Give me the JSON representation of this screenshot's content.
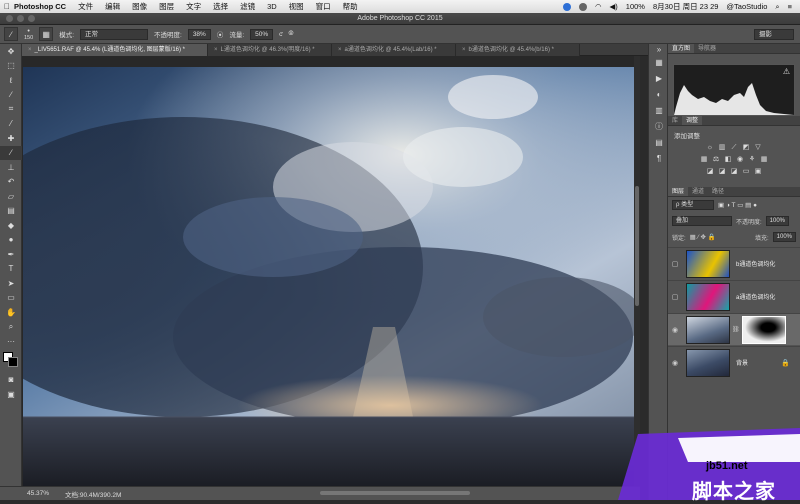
{
  "menubar": {
    "app_name": "Photoshop CC",
    "items": [
      "文件",
      "编辑",
      "图像",
      "图层",
      "文字",
      "选择",
      "滤镜",
      "3D",
      "视图",
      "窗口",
      "帮助"
    ],
    "battery": "100%",
    "datetime": "8月30日 周日  23 29",
    "user": "@TaoStudio"
  },
  "window": {
    "title": "Adobe Photoshop CC 2015"
  },
  "options": {
    "brush_size": "150",
    "mode_label": "模式:",
    "mode_value": "正常",
    "opacity_label": "不透明度:",
    "opacity_value": "38%",
    "flow_label": "流量:",
    "flow_value": "50%",
    "workspace": "摄影"
  },
  "tabs": [
    {
      "label": "_LIV5651.RAF @ 45.4% (L通道色调均化, 图层蒙版/16) *",
      "active": true
    },
    {
      "label": "L通道色调均化 @ 46.3%(明度/16) *",
      "active": false
    },
    {
      "label": "a通道色调均化 @ 45.4%(Lab/16) *",
      "active": false
    },
    {
      "label": "b通道色调均化 @ 45.4%(b/16) *",
      "active": false
    }
  ],
  "status": {
    "zoom": "45.37%",
    "doc": "文档:90.4M/390.2M"
  },
  "panels": {
    "top_tabs": [
      "直方图",
      "导航器"
    ],
    "mid_tabs": [
      "库",
      "调整"
    ],
    "adj_title": "添加调整",
    "layer_tabs": [
      "图层",
      "通道",
      "路径"
    ],
    "filter_label": "ρ 类型",
    "blend_mode": "叠加",
    "opacity_label": "不透明度:",
    "opacity_value": "100%",
    "lock_label": "锁定:",
    "fill_label": "填充:",
    "fill_value": "100%"
  },
  "layers": [
    {
      "name": "b通道色调均化",
      "visible": false
    },
    {
      "name": "a通道色调均化",
      "visible": false
    },
    {
      "name": "",
      "visible": true,
      "selected": true
    },
    {
      "name": "背景",
      "visible": true
    }
  ],
  "watermark": {
    "site": "jb51.net",
    "cn": "脚本之家"
  }
}
